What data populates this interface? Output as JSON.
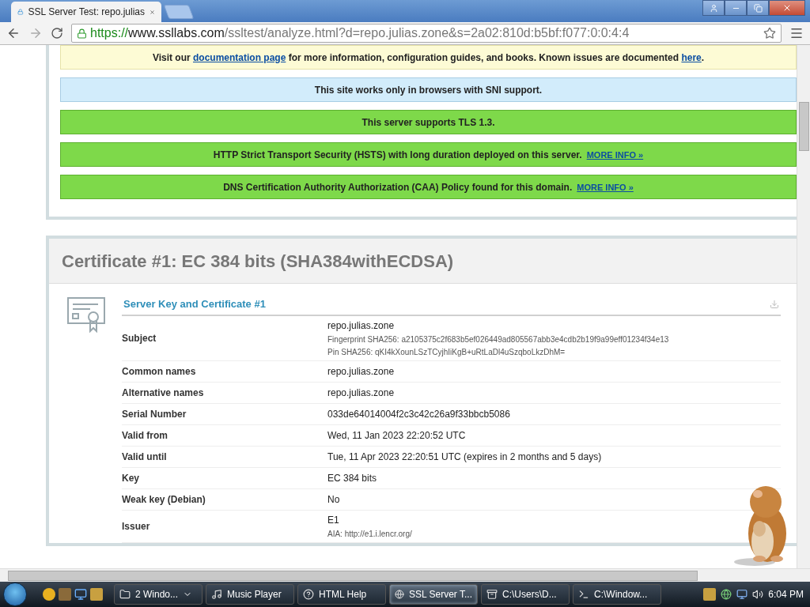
{
  "browser": {
    "tab_title": "SSL Server Test: repo.julias",
    "url": {
      "scheme": "https://",
      "host": "www.ssllabs.com",
      "path": "/ssltest/analyze.html?d=repo.julias.zone&s=2a02:810d:b5bf:f077:0:0:4:4"
    }
  },
  "notices": [
    {
      "kind": "yellow",
      "segments": [
        {
          "text": "Visit our ",
          "link": false
        },
        {
          "text": "documentation page",
          "link": true
        },
        {
          "text": " for more information, configuration guides, and books. Known issues are documented ",
          "link": false
        },
        {
          "text": "here",
          "link": true
        },
        {
          "text": ".",
          "link": false
        }
      ]
    },
    {
      "kind": "blue",
      "segments": [
        {
          "text": "This site works only in browsers with SNI support.",
          "link": false
        }
      ]
    },
    {
      "kind": "green",
      "segments": [
        {
          "text": "This server supports TLS 1.3.",
          "link": false
        }
      ]
    },
    {
      "kind": "green",
      "segments": [
        {
          "text": "HTTP Strict Transport Security (HSTS) with long duration deployed on this server.",
          "link": false
        },
        {
          "text": "MORE INFO »",
          "link": true
        }
      ]
    },
    {
      "kind": "green",
      "segments": [
        {
          "text": "DNS Certification Authority Authorization (CAA) Policy found for this domain.",
          "link": false
        },
        {
          "text": "MORE INFO »",
          "link": true
        }
      ]
    }
  ],
  "certificate": {
    "title": "Certificate #1: EC 384 bits (SHA384withECDSA)",
    "section_title": "Server Key and Certificate #1",
    "rows": [
      {
        "label": "Subject",
        "lines": [
          {
            "kind": "main",
            "text": "repo.julias.zone"
          },
          {
            "kind": "sub",
            "text": "Fingerprint SHA256: a2105375c2f683b5ef026449ad805567abb3e4cdb2b19f9a99eff01234f34e13"
          },
          {
            "kind": "sub",
            "text": "Pin SHA256: qKI4kXounLSzTCyjhIiKgB+uRtLaDl4uSzqboLkzDhM="
          }
        ]
      },
      {
        "label": "Common names",
        "lines": [
          {
            "kind": "main",
            "text": "repo.julias.zone"
          }
        ]
      },
      {
        "label": "Alternative names",
        "lines": [
          {
            "kind": "main",
            "text": "repo.julias.zone"
          }
        ]
      },
      {
        "label": "Serial Number",
        "lines": [
          {
            "kind": "main",
            "text": "033de64014004f2c3c42c26a9f33bbcb5086"
          }
        ]
      },
      {
        "label": "Valid from",
        "lines": [
          {
            "kind": "main",
            "text": "Wed, 11 Jan 2023 22:20:52 UTC"
          }
        ]
      },
      {
        "label": "Valid until",
        "lines": [
          {
            "kind": "main",
            "text": "Tue, 11 Apr 2023 22:20:51 UTC (expires in 2 months and 5 days)"
          }
        ]
      },
      {
        "label": "Key",
        "lines": [
          {
            "kind": "main",
            "text": "EC 384 bits"
          }
        ]
      },
      {
        "label": "Weak key (Debian)",
        "lines": [
          {
            "kind": "main",
            "text": "No"
          }
        ]
      },
      {
        "label": "Issuer",
        "lines": [
          {
            "kind": "main",
            "text": "E1"
          },
          {
            "kind": "sub",
            "text": "AIA: http://e1.i.lencr.org/"
          }
        ]
      }
    ]
  },
  "taskbar": {
    "items": [
      {
        "label": "2 Windo...",
        "selected": false
      },
      {
        "label": "Music Player",
        "selected": false
      },
      {
        "label": "HTML Help",
        "selected": false
      },
      {
        "label": "SSL Server T...",
        "selected": true
      },
      {
        "label": "C:\\Users\\D...",
        "selected": false
      },
      {
        "label": "C:\\Window...",
        "selected": false
      }
    ],
    "clock": "6:04 PM"
  }
}
